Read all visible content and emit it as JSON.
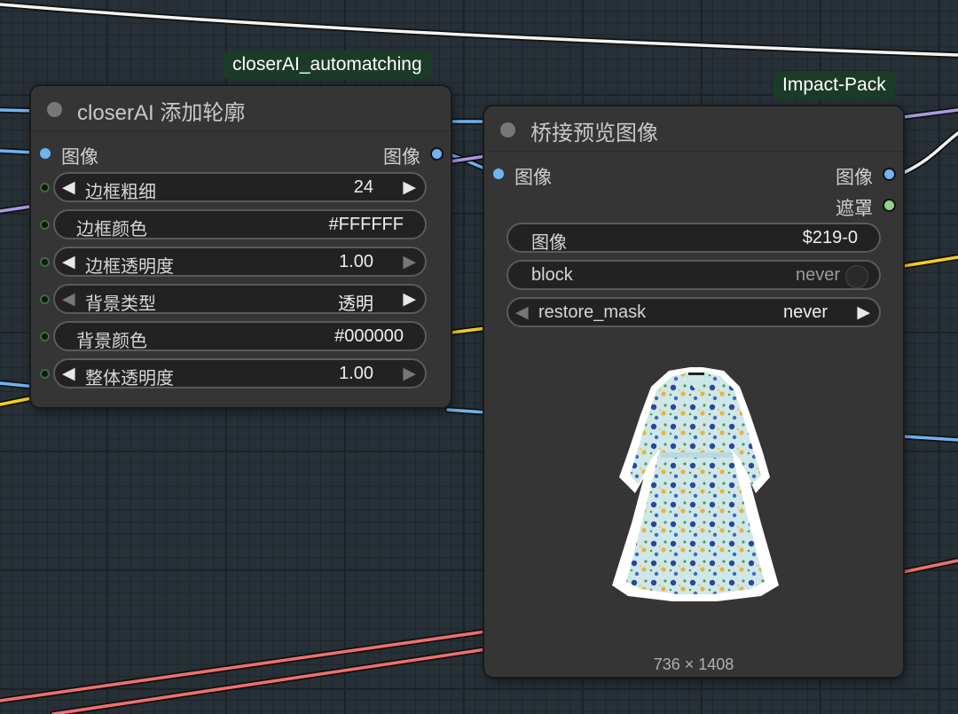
{
  "colors": {
    "image_port": "#6fb4f3",
    "mask_port": "#8fd18d",
    "badge_bg": "#1c3a28",
    "node_bg": "#353535",
    "wire_red": "#f07070",
    "wire_yellow": "#f0d020",
    "wire_purple": "#a99be0"
  },
  "left_node": {
    "badge": "closerAI_automatching",
    "title": "closerAI 添加轮廓",
    "input_label": "图像",
    "output_label": "图像",
    "widgets": [
      {
        "label": "边框粗细",
        "value": "24",
        "arrows": "both"
      },
      {
        "label": "边框颜色",
        "value": "#FFFFFF",
        "arrows": "none"
      },
      {
        "label": "边框透明度",
        "value": "1.00",
        "arrows": "left-active"
      },
      {
        "label": "背景类型",
        "value": "透明",
        "arrows": "right-active"
      },
      {
        "label": "背景颜色",
        "value": "#000000",
        "arrows": "none"
      },
      {
        "label": "整体透明度",
        "value": "1.00",
        "arrows": "left-active"
      }
    ]
  },
  "right_node": {
    "badge": "Impact-Pack",
    "title": "桥接预览图像",
    "input_label": "图像",
    "output_image_label": "图像",
    "output_mask_label": "遮罩",
    "widgets": [
      {
        "label": "图像",
        "value": "$219-0"
      },
      {
        "label": "block",
        "value": "never"
      },
      {
        "label": "restore_mask",
        "value": "never"
      }
    ],
    "preview_icon": "floral-dress-image",
    "preview_dims": "736 × 1408"
  }
}
